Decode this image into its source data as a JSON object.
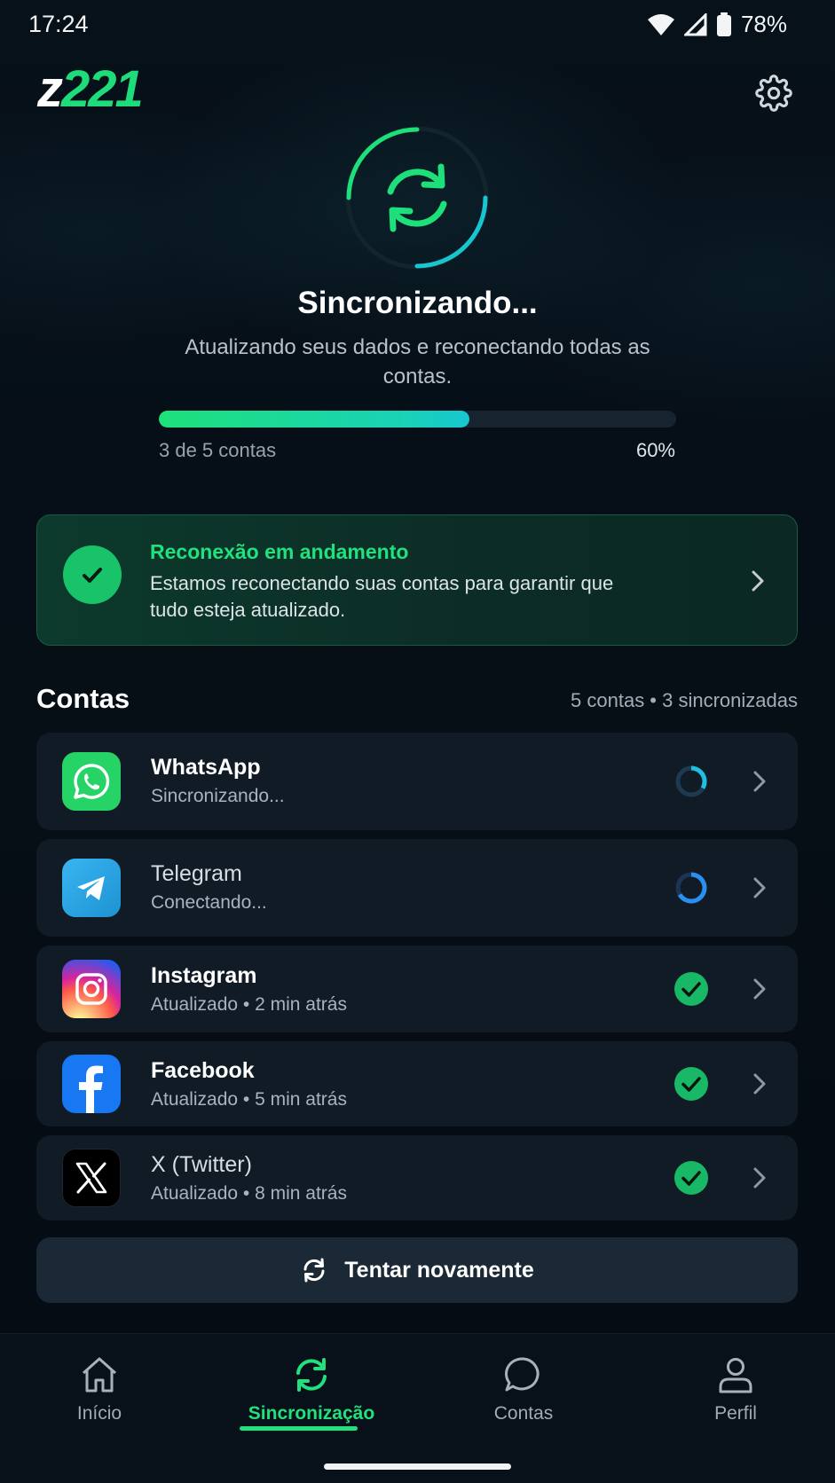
{
  "status_bar": {
    "time": "17:24",
    "battery": "78%",
    "icons": [
      "wifi-icon",
      "signal-icon",
      "battery-icon"
    ]
  },
  "header": {
    "logo_prefix": "z",
    "logo_number": "221",
    "settings_icon": "gear-icon"
  },
  "sync": {
    "title": "Sincronizando...",
    "subtitle": "Atualizando seus dados e reconectando todas as contas.",
    "progress_label": "3 de 5 contas",
    "progress_percent_text": "60%",
    "progress_value": 0.6
  },
  "reconnect_card": {
    "title": "Reconexão em andamento",
    "text": "Estamos reconectando suas contas para garantir que tudo esteja atualizado."
  },
  "accounts_section": {
    "title": "Contas",
    "meta": "5 contas • 3 sincronizadas",
    "items": [
      {
        "name": "WhatsApp",
        "status": "Sincronizando...",
        "state": "syncing",
        "icon": "whatsapp-icon"
      },
      {
        "name": "Telegram",
        "status": "Conectando...",
        "state": "connecting",
        "icon": "telegram-icon"
      },
      {
        "name": "Instagram",
        "status": "Atualizado • 2 min atrás",
        "state": "done",
        "icon": "instagram-icon"
      },
      {
        "name": "Facebook",
        "status": "Atualizado • 5 min atrás",
        "state": "done",
        "icon": "facebook-icon"
      },
      {
        "name": "X (Twitter)",
        "status": "Atualizado • 8 min atrás",
        "state": "done",
        "icon": "x-icon"
      }
    ]
  },
  "retry_button": {
    "label": "Tentar novamente"
  },
  "bottom_nav": {
    "items": [
      {
        "label": "Início",
        "icon": "home-icon",
        "active": false
      },
      {
        "label": "Sincronização",
        "icon": "sync-icon",
        "active": true
      },
      {
        "label": "Contas",
        "icon": "chat-icon",
        "active": false
      },
      {
        "label": "Perfil",
        "icon": "user-icon",
        "active": false
      }
    ]
  },
  "colors": {
    "accent": "#22e07d",
    "background": "#060d14",
    "card": "#101b26",
    "progress_end": "#18c6d0"
  }
}
